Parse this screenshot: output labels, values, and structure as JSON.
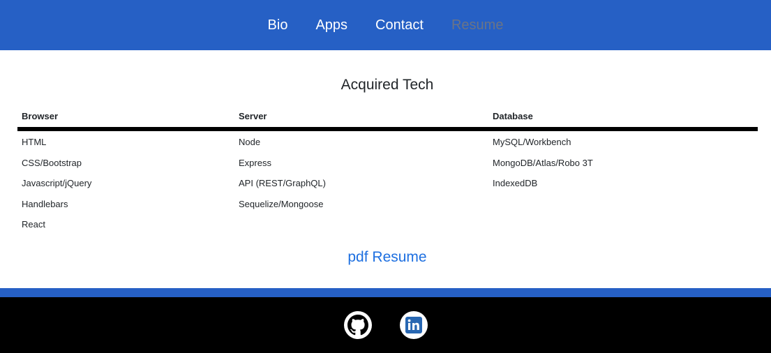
{
  "nav": {
    "items": [
      {
        "label": "Bio"
      },
      {
        "label": "Apps"
      },
      {
        "label": "Contact"
      },
      {
        "label": "Resume"
      }
    ],
    "active": "Resume"
  },
  "main": {
    "heading": "Acquired Tech",
    "table": {
      "columns": [
        "Browser",
        "Server",
        "Database"
      ],
      "rows": [
        [
          "HTML",
          "Node",
          "MySQL/Workbench"
        ],
        [
          "CSS/Bootstrap",
          "Express",
          "MongoDB/Atlas/Robo 3T"
        ],
        [
          "Javascript/jQuery",
          "API (REST/GraphQL)",
          "IndexedDB"
        ],
        [
          "Handlebars",
          "Sequelize/Mongoose",
          ""
        ],
        [
          "React",
          "",
          ""
        ]
      ]
    },
    "pdf_link": "pdf Resume"
  },
  "footer": {
    "icons": [
      "github-icon",
      "linkedin-icon"
    ]
  },
  "colors": {
    "brand_blue": "#2660c5",
    "link_blue": "#1d6fe0",
    "inactive_nav": "#6b7486",
    "footer_bg": "#000000"
  }
}
